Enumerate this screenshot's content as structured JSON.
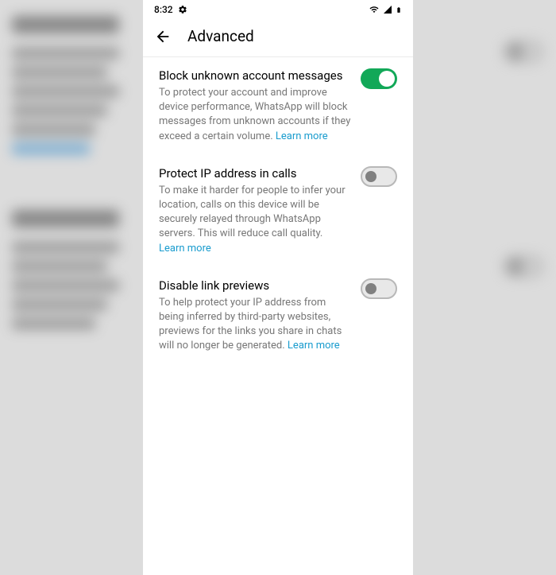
{
  "status": {
    "time": "8:32"
  },
  "header": {
    "title": "Advanced"
  },
  "settings": [
    {
      "title": "Block unknown account messages",
      "description": "To protect your account and improve device performance, WhatsApp will block messages from unknown accounts if they exceed a certain volume.",
      "learn_more": "Learn more",
      "enabled": true
    },
    {
      "title": "Protect IP address in calls",
      "description": "To make it harder for people to infer your location, calls on this device will be securely relayed through WhatsApp servers. This will reduce call quality.",
      "learn_more": "Learn more",
      "enabled": false
    },
    {
      "title": "Disable link previews",
      "description": "To help protect your IP address from being inferred by third-party websites, previews for the links you share in chats will no longer be generated.",
      "learn_more": "Learn more",
      "enabled": false
    }
  ]
}
